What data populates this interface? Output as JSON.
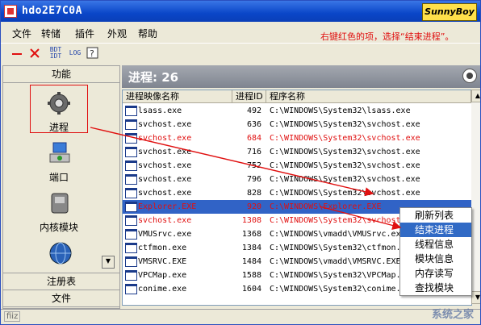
{
  "window": {
    "title": "hdo2E7C0A",
    "brand": "SunnyBoy"
  },
  "menu": [
    "文件",
    "转储",
    "插件",
    "外观",
    "帮助"
  ],
  "hint": "右键红色的项，选择“结束进程”。",
  "toolbar": {
    "b1": "BDT\nIDT",
    "b2": "LOG"
  },
  "left_panel": {
    "header": "功能",
    "items": [
      {
        "label": "进程",
        "icon": "gear-icon"
      },
      {
        "label": "端口",
        "icon": "network-icon"
      },
      {
        "label": "内核模块",
        "icon": "chip-icon"
      },
      {
        "label": "",
        "icon": "globe-icon"
      }
    ],
    "footer1": "注册表",
    "footer2": "文件"
  },
  "process_header": "进程: 26",
  "columns": [
    "进程映像名称",
    "进程ID",
    "程序名称"
  ],
  "rows": [
    {
      "name": "lsass.exe",
      "pid": "492",
      "path": "C:\\WINDOWS\\System32\\lsass.exe",
      "state": "normal"
    },
    {
      "name": "svchost.exe",
      "pid": "636",
      "path": "C:\\WINDOWS\\System32\\svchost.exe",
      "state": "normal"
    },
    {
      "name": "svchost.exe",
      "pid": "684",
      "path": "C:\\WINDOWS\\System32\\svchost.exe",
      "state": "red"
    },
    {
      "name": "svchost.exe",
      "pid": "716",
      "path": "C:\\WINDOWS\\System32\\svchost.exe",
      "state": "normal"
    },
    {
      "name": "svchost.exe",
      "pid": "752",
      "path": "C:\\WINDOWS\\System32\\svchost.exe",
      "state": "normal"
    },
    {
      "name": "svchost.exe",
      "pid": "796",
      "path": "C:\\WINDOWS\\System32\\svchost.exe",
      "state": "normal"
    },
    {
      "name": "svchost.exe",
      "pid": "828",
      "path": "C:\\WINDOWS\\System32\\svchost.exe",
      "state": "normal"
    },
    {
      "name": "Explorer.EXE",
      "pid": "920",
      "path": "C:\\WINDOWS\\Explorer.EXE",
      "state": "selected"
    },
    {
      "name": "svchost.exe",
      "pid": "1308",
      "path": "C:\\WINDOWS\\System32\\svchost.exe",
      "state": "red"
    },
    {
      "name": "VMUSrvc.exe",
      "pid": "1368",
      "path": "C:\\WINDOWS\\vmadd\\VMUSrvc.exe",
      "state": "normal"
    },
    {
      "name": "ctfmon.exe",
      "pid": "1384",
      "path": "C:\\WINDOWS\\System32\\ctfmon.exe",
      "state": "normal"
    },
    {
      "name": "VMSRVC.EXE",
      "pid": "1484",
      "path": "C:\\WINDOWS\\vmadd\\VMSRVC.EXE",
      "state": "normal"
    },
    {
      "name": "VPCMap.exe",
      "pid": "1588",
      "path": "C:\\WINDOWS\\System32\\VPCMap.exe",
      "state": "normal"
    },
    {
      "name": "conime.exe",
      "pid": "1604",
      "path": "C:\\WINDOWS\\System32\\conime.exe",
      "state": "normal"
    }
  ],
  "context_menu": [
    "刷新列表",
    "结束进程",
    "线程信息",
    "模块信息",
    "内存读写",
    "查找模块"
  ],
  "status": "fiiz",
  "watermark": "系统之家",
  "colors": {
    "accent": "#e01010",
    "selection": "#3163c6",
    "title": "#0a46c8"
  }
}
